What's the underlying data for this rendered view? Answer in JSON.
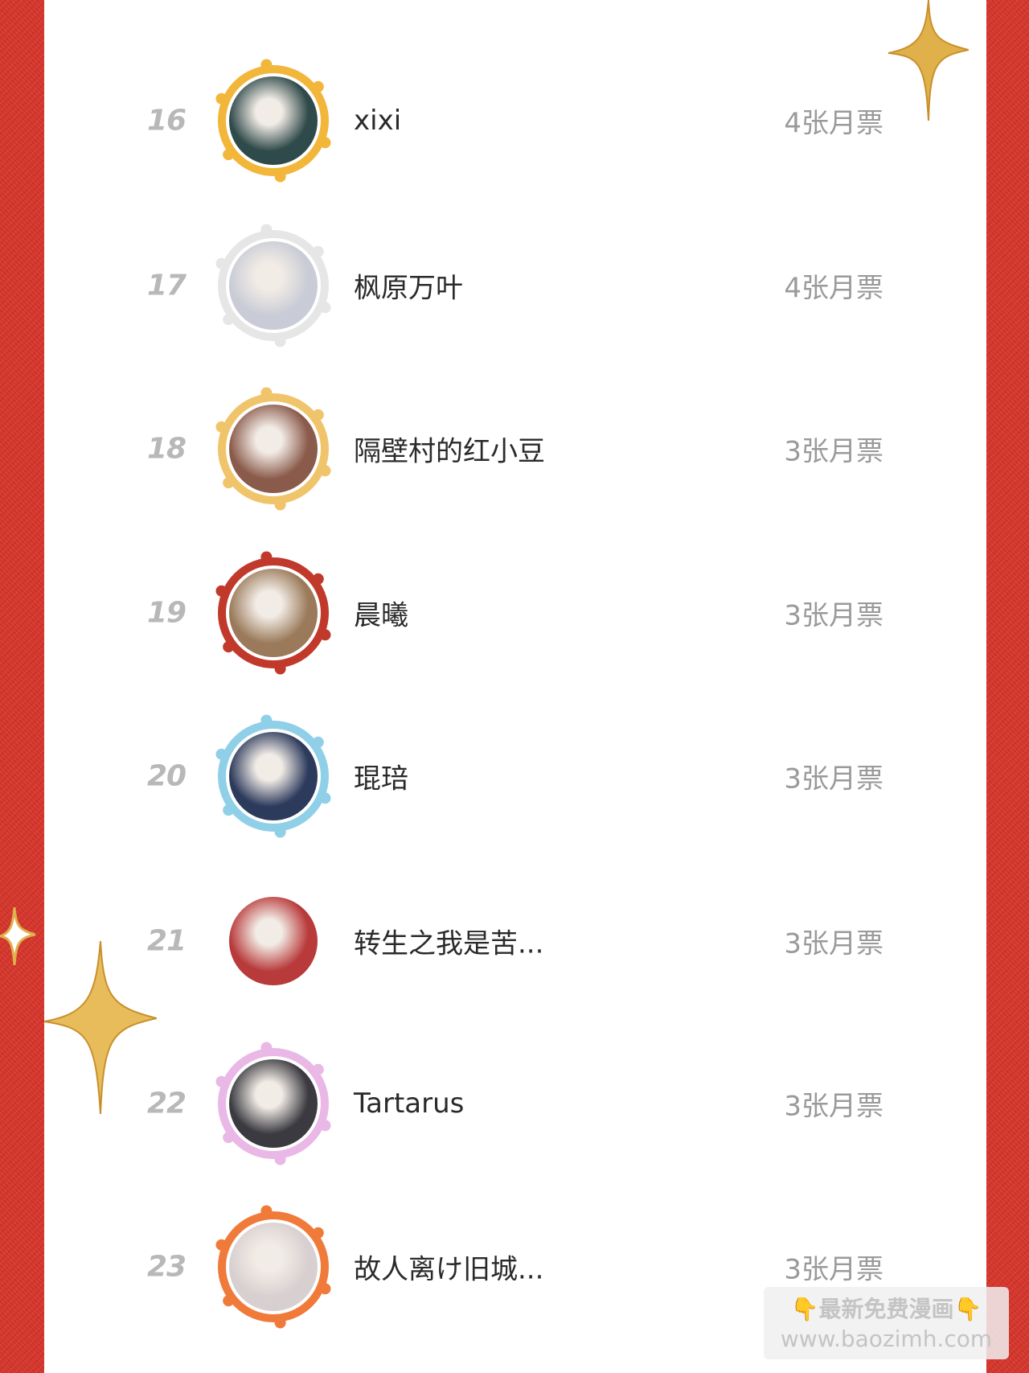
{
  "colors": {
    "background_red": "#d8352b",
    "card": "#ffffff",
    "rank": "#b8b8b8",
    "name": "#2a2a2a",
    "votes": "#9a9a9a",
    "sparkle_gold": "#e0b04a"
  },
  "leaderboard": {
    "rows": [
      {
        "rank": "16",
        "name": "xixi",
        "votes": "4张月票",
        "frame": "flower-frame",
        "avatar_color": "#2f4a4a"
      },
      {
        "rank": "17",
        "name": "枫原万叶",
        "votes": "4张月票",
        "frame": "graduation-cap-frame",
        "avatar_color": "#c9ccd6"
      },
      {
        "rank": "18",
        "name": "隔壁村的红小豆",
        "votes": "3张月票",
        "frame": "anniversary-frame",
        "avatar_color": "#8a5a4a"
      },
      {
        "rank": "19",
        "name": "晨曦",
        "votes": "3张月票",
        "frame": "fortune-frame",
        "avatar_color": "#9a7a5a"
      },
      {
        "rank": "20",
        "name": "琨琣",
        "votes": "3张月票",
        "frame": "wave-frame",
        "avatar_color": "#2c3a5c"
      },
      {
        "rank": "21",
        "name": "转生之我是苦...",
        "votes": "3张月票",
        "frame": "none",
        "avatar_color": "#b83a3a"
      },
      {
        "rank": "22",
        "name": "Tartarus",
        "votes": "3张月票",
        "frame": "heart-wings-frame",
        "avatar_color": "#3a3a40"
      },
      {
        "rank": "23",
        "name": "故人离け旧城...",
        "votes": "3张月票",
        "frame": "crab-frame",
        "avatar_color": "#d8d0d0"
      }
    ]
  },
  "watermark": {
    "line1": "👇最新免费漫画👇",
    "line2": "www.baozimh.com"
  }
}
